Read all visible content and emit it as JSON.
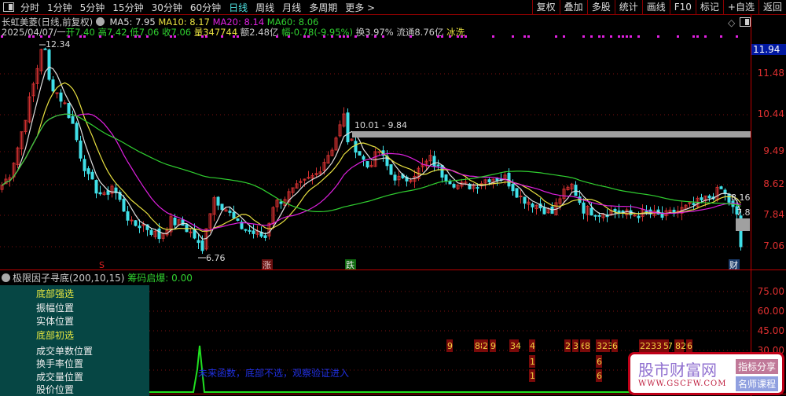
{
  "toolbar": {
    "tabs": [
      "分时",
      "1分钟",
      "5分钟",
      "15分钟",
      "30分钟",
      "60分钟",
      "日线",
      "周线",
      "月线",
      "多周期",
      "更多 >"
    ],
    "active": 6,
    "right_buttons": [
      "复权",
      "叠加",
      "多股",
      "统计",
      "画线",
      "F10",
      "标记",
      "+自选",
      "返回"
    ]
  },
  "header": {
    "name": "长虹美菱(日线,前复权)",
    "ma5": "MA5: 7.95",
    "ma10": "MA10: 8.17",
    "ma20": "MA20: 8.14",
    "ma60": "MA60: 8.06",
    "date": "2025/04/07/一",
    "open": "开7.40",
    "high": "高7.42",
    "low": "低7.06",
    "close": "收7.06",
    "vol": "量347744",
    "amount": "额2.48亿",
    "change": "幅-0.78(-9.95%)",
    "turnover": "换3.97%",
    "float": "流通8.76亿",
    "tag": "冰洗"
  },
  "price_axis": {
    "current": "11.94",
    "labels": [
      "11.48",
      "10.44",
      "9.49",
      "8.62",
      "7.84",
      "7.06"
    ]
  },
  "annotations": {
    "high": "12.34",
    "low": "6.76",
    "range": "10.01 - 9.84",
    "last_hi": "8.16",
    "last_lo": "7.8",
    "markers": [
      "S",
      "涨",
      "跌",
      "财"
    ]
  },
  "colors": {
    "up": "#d03030",
    "down": "#40e0e8",
    "ma5": "#e0e0e0",
    "ma10": "#e8e040",
    "ma20": "#e020e0",
    "ma60": "#30d030"
  },
  "chart_data": {
    "type": "candlestick",
    "keypoints": [
      [
        0,
        8.6
      ],
      [
        2,
        8.9
      ],
      [
        4,
        9.6
      ],
      [
        6,
        10.4
      ],
      [
        8,
        11.2
      ],
      [
        10,
        12.0
      ],
      [
        11,
        11.9
      ],
      [
        12,
        11.3
      ],
      [
        14,
        11.0
      ],
      [
        16,
        10.7
      ],
      [
        18,
        10.2
      ],
      [
        20,
        9.4
      ],
      [
        22,
        8.8
      ],
      [
        24,
        8.5
      ],
      [
        26,
        8.3
      ],
      [
        28,
        8.6
      ],
      [
        30,
        8.2
      ],
      [
        33,
        7.6
      ],
      [
        36,
        7.6
      ],
      [
        40,
        7.3
      ],
      [
        43,
        7.7
      ],
      [
        46,
        7.6
      ],
      [
        49,
        7.3
      ],
      [
        51,
        6.9
      ],
      [
        52,
        7.6
      ],
      [
        54,
        8.3
      ],
      [
        57,
        8.0
      ],
      [
        60,
        7.6
      ],
      [
        64,
        7.4
      ],
      [
        67,
        7.3
      ],
      [
        69,
        8.1
      ],
      [
        72,
        8.3
      ],
      [
        76,
        8.6
      ],
      [
        80,
        8.9
      ],
      [
        84,
        9.6
      ],
      [
        87,
        10.4
      ],
      [
        88,
        9.8
      ],
      [
        90,
        9.6
      ],
      [
        93,
        9.1
      ],
      [
        96,
        9.5
      ],
      [
        99,
        8.9
      ],
      [
        102,
        8.7
      ],
      [
        106,
        9.0
      ],
      [
        109,
        9.3
      ],
      [
        112,
        8.9
      ],
      [
        116,
        8.6
      ],
      [
        120,
        8.6
      ],
      [
        124,
        8.8
      ],
      [
        128,
        8.8
      ],
      [
        132,
        8.3
      ],
      [
        136,
        8.1
      ],
      [
        140,
        7.9
      ],
      [
        142,
        8.3
      ],
      [
        145,
        8.6
      ],
      [
        148,
        8.0
      ],
      [
        152,
        7.9
      ],
      [
        156,
        7.95
      ],
      [
        160,
        7.85
      ],
      [
        164,
        7.9
      ],
      [
        168,
        7.8
      ],
      [
        172,
        7.95
      ],
      [
        176,
        8.1
      ],
      [
        180,
        8.3
      ],
      [
        183,
        8.5
      ],
      [
        185,
        8.2
      ],
      [
        187,
        7.8
      ],
      [
        188,
        7.06
      ]
    ]
  },
  "indicator": {
    "title": "极限因子寻底(200,10,15)",
    "value": "筹码启爆: 0.00",
    "axis": [
      "75.00",
      "60.00",
      "45.00",
      "30.00"
    ],
    "rows": [
      "底部强选",
      "振幅位置",
      "实体位置",
      "底部初选",
      "成交单数位置",
      "换手率位置",
      "成交量位置",
      "股价位置"
    ],
    "note": "未来函数，底部不选，观察验证进入",
    "signals": [
      [
        114,
        "9"
      ],
      [
        121,
        "88"
      ],
      [
        123,
        "2"
      ],
      [
        125,
        "9"
      ],
      [
        130,
        "34"
      ],
      [
        135,
        "4"
      ],
      [
        144,
        "2"
      ],
      [
        146,
        "3"
      ],
      [
        148,
        "6"
      ],
      [
        149,
        "8"
      ],
      [
        152,
        "323"
      ],
      [
        156,
        "6"
      ],
      [
        163,
        "223377"
      ],
      [
        169,
        "5"
      ],
      [
        172,
        "82"
      ],
      [
        175,
        "6"
      ]
    ],
    "signals2": [
      [
        135,
        "1"
      ],
      [
        152,
        "6"
      ]
    ]
  },
  "logo": {
    "name": "股市财富网",
    "url": "WWW.GSCFW.COM",
    "b1": "指标分享",
    "b2": "名师课程"
  }
}
